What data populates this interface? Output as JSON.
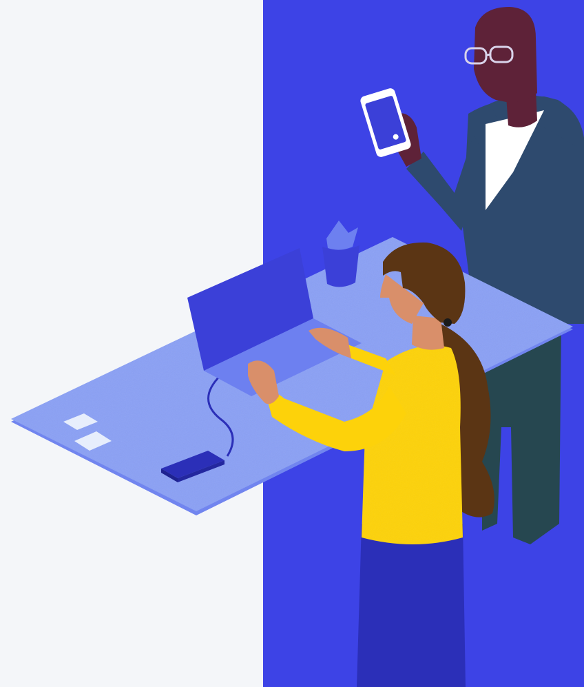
{
  "scene": {
    "subject": "illustration",
    "colors": {
      "left_background": "#f4f6f9",
      "right_background": "#3d43e6",
      "desk": "#8aa0f5",
      "desk_shadow": "#7185ef",
      "laptop": "#3b40d8",
      "laptop_base": "#6d80f0",
      "woman_shirt": "#fdd20a",
      "woman_pants": "#2b2fb8",
      "woman_hair": "#5b3514",
      "woman_skin": "#d98f6a",
      "man_skin": "#5e2238",
      "man_hoodie": "#2e4a6e",
      "man_pants": "#264750",
      "man_shirt": "#ffffff",
      "phone_screen": "#3b40d8",
      "cup": "#3b40d8"
    },
    "objects": [
      "desk",
      "laptop",
      "power-bank",
      "cable",
      "sticky-notes",
      "pen-cup",
      "smartphone",
      "glasses"
    ],
    "people": [
      "woman-typing",
      "man-with-phone"
    ]
  }
}
